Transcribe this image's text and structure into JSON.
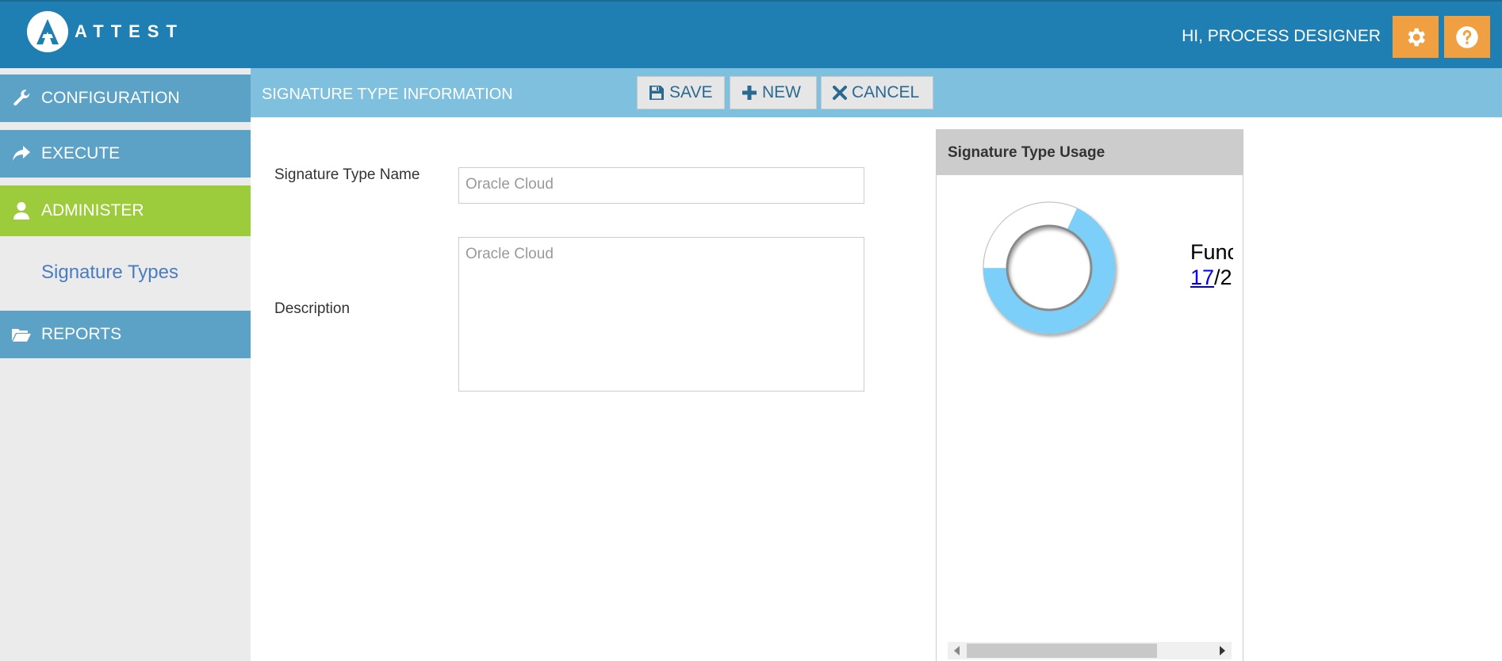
{
  "header": {
    "logo_text": "ATTEST",
    "greeting": "HI, PROCESS DESIGNER",
    "settings_icon": "gear-icon",
    "help_icon": "question-circle-icon"
  },
  "sidebar": {
    "items": [
      {
        "label": "CONFIGURATION",
        "icon": "wrench-icon"
      },
      {
        "label": "EXECUTE",
        "icon": "share-arrow-icon"
      },
      {
        "label": "ADMINISTER",
        "icon": "user-icon"
      },
      {
        "label": "REPORTS",
        "icon": "folder-open-icon"
      }
    ],
    "sub_items": [
      {
        "label": "Signature Types"
      }
    ]
  },
  "toolbar": {
    "title": "SIGNATURE TYPE INFORMATION",
    "save_label": "SAVE",
    "new_label": "NEW",
    "cancel_label": "CANCEL"
  },
  "form": {
    "name_label": "Signature Type Name",
    "name_value": "Oracle Cloud",
    "description_label": "Description",
    "description_value": "Oracle Cloud"
  },
  "usage": {
    "title": "Signature Type Usage",
    "label_partial": "Func",
    "count": "17",
    "total_partial": "/2",
    "fraction": 0.68
  },
  "colors": {
    "header": "#1f7fb2",
    "nav_blue": "#5ba2c6",
    "nav_active": "#9ccc3c",
    "accent_orange": "#f0a040",
    "toolbar": "#7fc0df",
    "donut_fill": "#7ccff8"
  }
}
